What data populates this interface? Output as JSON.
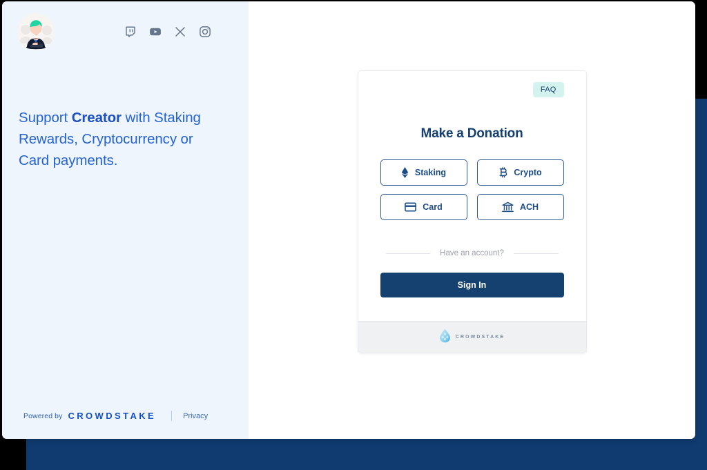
{
  "page": {
    "backdrop_color": "#103b71",
    "left_panel_bg": "#eef5fd",
    "accent_navy": "#14416f",
    "accent_blue": "#2563d4"
  },
  "left": {
    "avatar_alt": "creator-avatar",
    "social": [
      {
        "name": "twitch-icon",
        "label": "Twitch"
      },
      {
        "name": "youtube-icon",
        "label": "YouTube"
      },
      {
        "name": "x-icon",
        "label": "X"
      },
      {
        "name": "instagram-icon",
        "label": "Instagram"
      }
    ],
    "headline": {
      "before": "Support ",
      "strong": "Creator",
      "after": " with Staking Rewards, Cryptocurrency or Card payments."
    },
    "footer": {
      "powered_by": "Powered by",
      "brand": "CROWDSTAKE",
      "privacy": "Privacy"
    }
  },
  "card": {
    "faq_label": "FAQ",
    "title": "Make a Donation",
    "methods": [
      {
        "label": "Staking",
        "icon": "ethereum-icon"
      },
      {
        "label": "Crypto",
        "icon": "bitcoin-icon"
      },
      {
        "label": "Card",
        "icon": "credit-card-icon"
      },
      {
        "label": "ACH",
        "icon": "bank-icon"
      }
    ],
    "divider_text": "Have an account?",
    "signin_label": "Sign In",
    "footer_brand": "CROWDSTAKE"
  }
}
